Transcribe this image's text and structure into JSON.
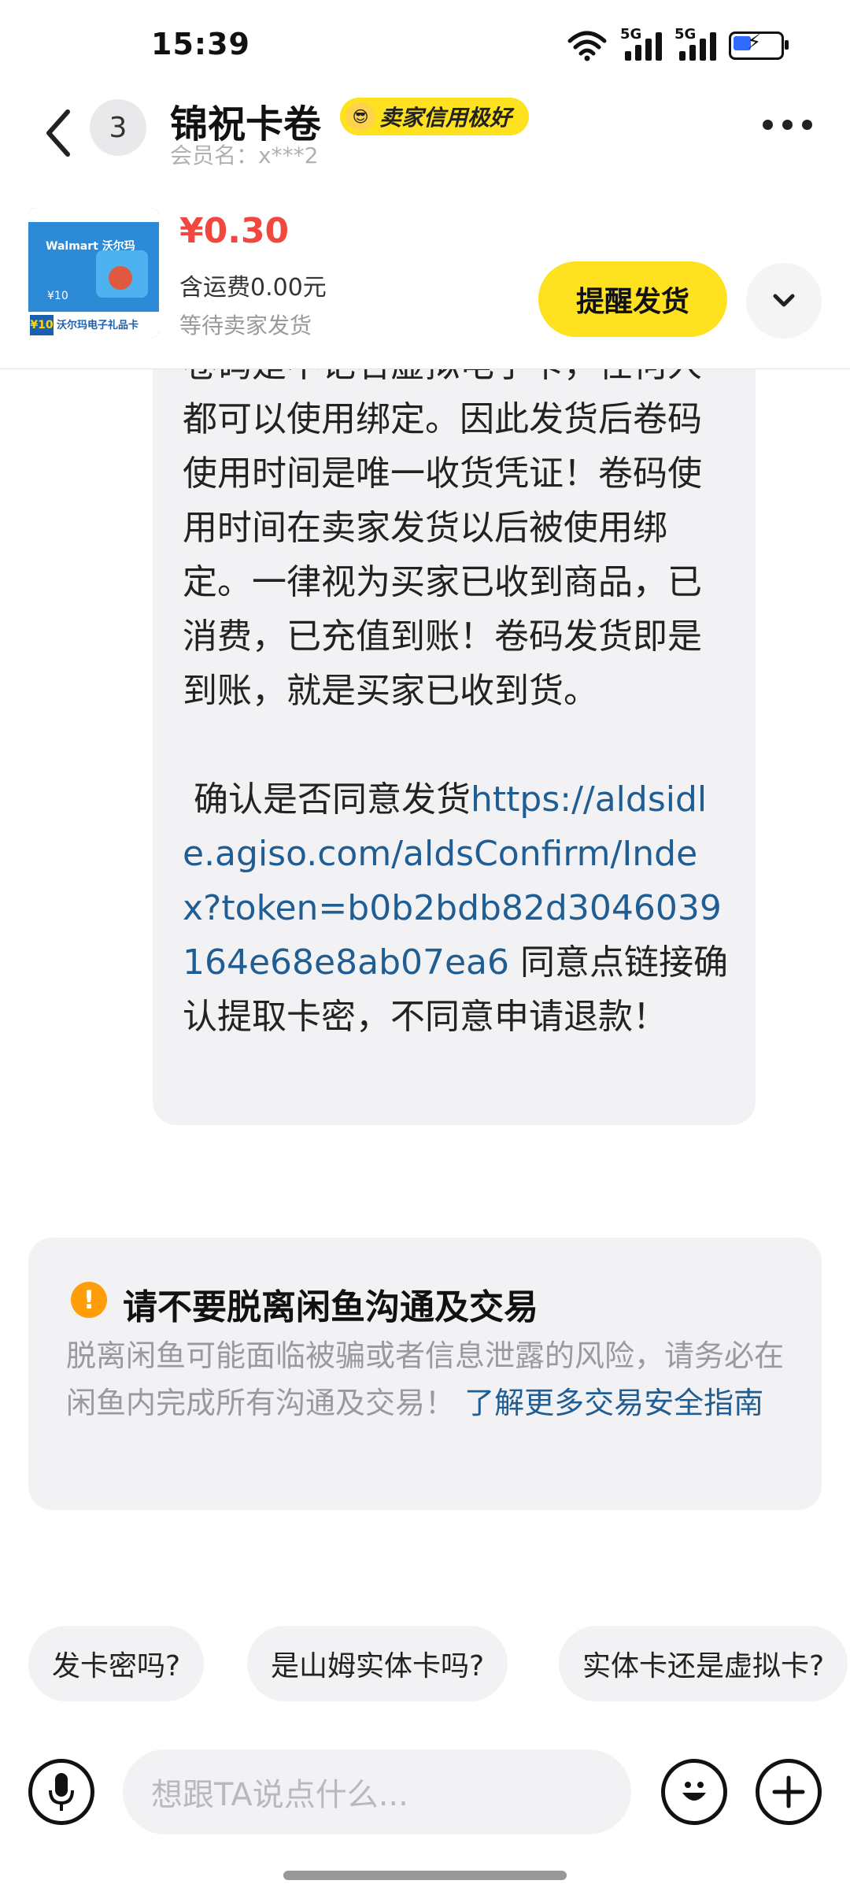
{
  "status_bar": {
    "time": "15:39",
    "signal1": "5G",
    "signal2": "5G"
  },
  "header": {
    "unread_count": "3",
    "shop_name": "锦祝卡卷",
    "credit_badge": "卖家信用极好",
    "member_label": "会员名：x***2"
  },
  "product": {
    "thumb_brand": "Walmart 沃尔玛",
    "thumb_value": "¥10",
    "thumb_badge": "¥10",
    "thumb_caption": "沃尔玛电子礼品卡",
    "price": "¥0.30",
    "shipping": "含运费0.00元",
    "status": "等待卖家发货",
    "remind_button": "提醒发货"
  },
  "message": {
    "paragraph1": "卷码是不记名虚拟电子卡，任何人都可以使用绑定。因此发货后卷码使用时间是唯一收货凭证！卷码使用时间在卖家发货以后被使用绑定。一律视为买家已收到商品，已消费，已充值到账！卷码发货即是到账，就是买家已收到货。",
    "confirm_prefix": " 确认是否同意发货",
    "link": "https://aldsidle.agiso.com/aldsConfirm/Index?token=b0b2bdb82d3046039164e68e8ab07ea6",
    "confirm_suffix": " 同意点链接确认提取卡密，不同意申请退款！"
  },
  "safety_notice": {
    "title": "请不要脱离闲鱼沟通及交易",
    "desc": "脱离闲鱼可能面临被骗或者信息泄露的风险，请务必在闲鱼内完成所有沟通及交易！",
    "link": " 了解更多交易安全指南"
  },
  "quick_replies": [
    "发卡密吗?",
    "是山姆实体卡吗?",
    "实体卡还是虚拟卡?"
  ],
  "input": {
    "placeholder": "想跟TA说点什么..."
  }
}
